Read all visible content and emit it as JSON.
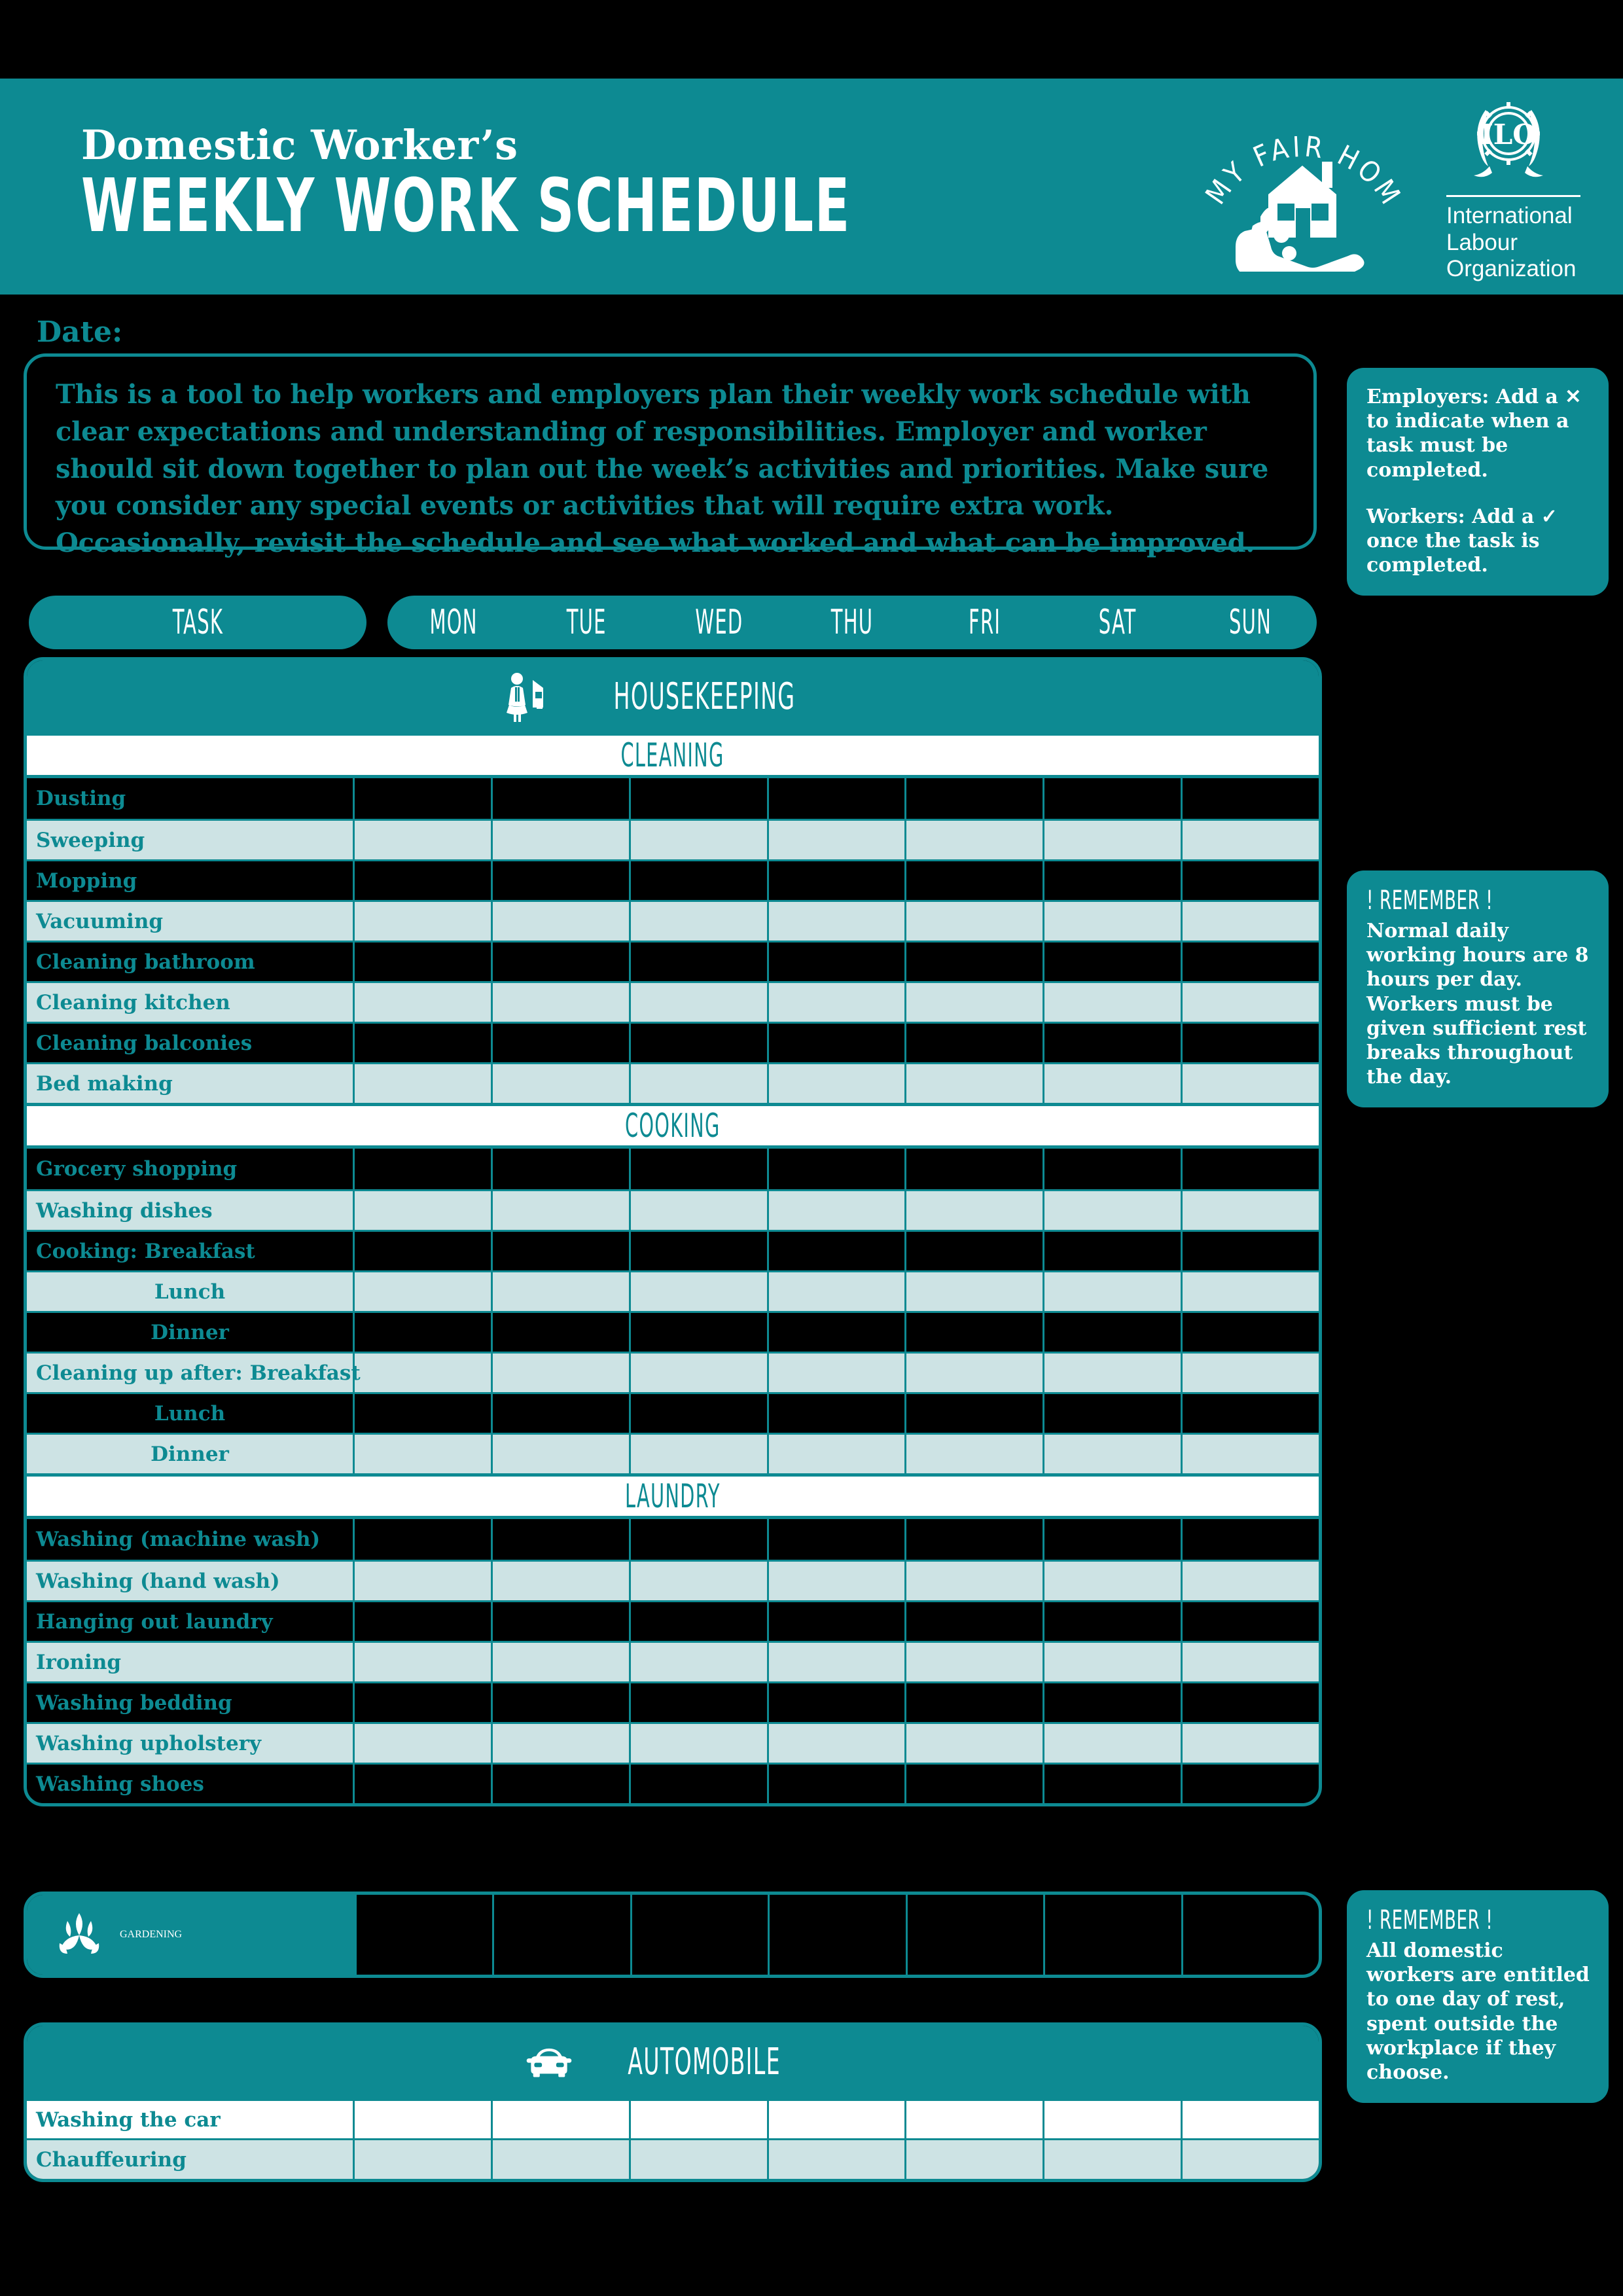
{
  "header": {
    "title_small": "Domestic Worker’s",
    "title_large": "WEEKLY WORK SCHEDULE",
    "brand_arc": "MY FAIR HOME",
    "ilo_abbr": "ILO",
    "ilo_line1": "International",
    "ilo_line2": "Labour",
    "ilo_line3": "Organization",
    "accent_color": "#0d8a92"
  },
  "date": {
    "label": "Date:"
  },
  "intro": {
    "text": "This is a tool to help workers and employers plan their weekly work schedule with clear expectations and understanding of responsibilities. Employer and worker should sit down together to plan out the week’s activities and priorities. Make sure you consider any special events or activities that will require extra work. Occasionally, revisit the schedule and see what worked and what can be improved."
  },
  "notes": {
    "legend": {
      "line1": "Employers: Add a ✕ to indicate when a task must be completed.",
      "line2": "Workers: Add a ✓ once the task is completed."
    },
    "remember1": {
      "heading": "! REMEMBER !",
      "text": "Normal daily working hours are 8 hours per day. Workers must be given sufficient rest breaks throughout the day."
    },
    "remember2": {
      "heading": "! REMEMBER !",
      "text": "All domestic workers are entitled to one day of rest, spent outside the workplace if they choose."
    }
  },
  "table": {
    "task_header": "TASK",
    "days": [
      "MON",
      "TUE",
      "WED",
      "THU",
      "FRI",
      "SAT",
      "SUN"
    ]
  },
  "sections": [
    {
      "name": "HOUSEKEEPING",
      "icon": "housekeeper-icon",
      "groups": [
        {
          "title": "CLEANING",
          "tasks": [
            {
              "label": "Dusting",
              "indent": false
            },
            {
              "label": "Sweeping",
              "indent": false
            },
            {
              "label": "Mopping",
              "indent": false
            },
            {
              "label": "Vacuuming",
              "indent": false
            },
            {
              "label": "Cleaning bathroom",
              "indent": false
            },
            {
              "label": "Cleaning kitchen",
              "indent": false
            },
            {
              "label": "Cleaning balconies",
              "indent": false
            },
            {
              "label": "Bed making",
              "indent": false
            }
          ]
        },
        {
          "title": "COOKING",
          "tasks": [
            {
              "label": "Grocery shopping",
              "indent": false
            },
            {
              "label": "Washing dishes",
              "indent": false
            },
            {
              "label": "Cooking: Breakfast",
              "indent": false
            },
            {
              "label": "Lunch",
              "indent": true
            },
            {
              "label": "Dinner",
              "indent": true
            },
            {
              "label": "Cleaning up after: Breakfast",
              "indent": false
            },
            {
              "label": "Lunch",
              "indent": true
            },
            {
              "label": "Dinner",
              "indent": true
            }
          ]
        },
        {
          "title": "LAUNDRY",
          "tasks": [
            {
              "label": "Washing (machine wash)",
              "indent": false
            },
            {
              "label": "Washing (hand wash)",
              "indent": false
            },
            {
              "label": "Hanging out laundry",
              "indent": false
            },
            {
              "label": "Ironing",
              "indent": false
            },
            {
              "label": "Washing bedding",
              "indent": false
            },
            {
              "label": "Washing upholstery",
              "indent": false
            },
            {
              "label": "Washing shoes",
              "indent": false
            }
          ]
        }
      ]
    },
    {
      "name": "GARDENING",
      "icon": "plant-icon",
      "groups": []
    },
    {
      "name": "AUTOMOBILE",
      "icon": "car-icon",
      "groups": [
        {
          "title": "",
          "tasks": [
            {
              "label": "Washing the car",
              "indent": false
            },
            {
              "label": "Chauffeuring",
              "indent": false
            }
          ]
        }
      ]
    }
  ]
}
